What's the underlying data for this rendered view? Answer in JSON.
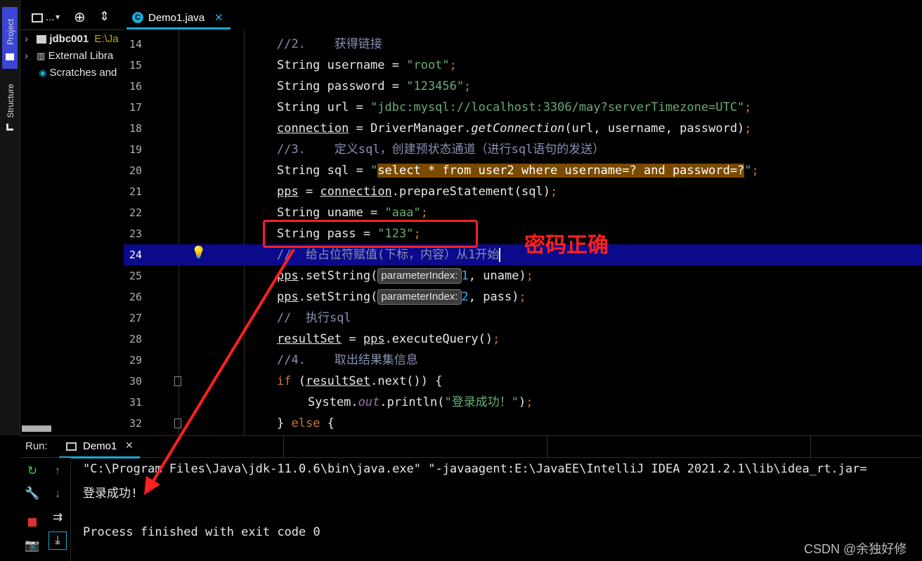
{
  "left_strip": {
    "project_label": "Project",
    "structure_label": "Structure"
  },
  "project_panel": {
    "toolbar_title": "...",
    "tree": [
      {
        "label": "jdbc001",
        "path": "E:\\Ja",
        "icon": "module-folder-icon"
      },
      {
        "label": "External Libra",
        "icon": "library-icon"
      },
      {
        "label": "Scratches and",
        "icon": "scratches-icon"
      }
    ]
  },
  "editor": {
    "tab_label": "Demo1.java",
    "lines": [
      {
        "n": "14"
      },
      {
        "n": "15"
      },
      {
        "n": "16"
      },
      {
        "n": "17"
      },
      {
        "n": "18"
      },
      {
        "n": "19"
      },
      {
        "n": "20"
      },
      {
        "n": "21"
      },
      {
        "n": "22"
      },
      {
        "n": "23"
      },
      {
        "n": "24"
      },
      {
        "n": "25"
      },
      {
        "n": "26"
      },
      {
        "n": "27"
      },
      {
        "n": "28"
      },
      {
        "n": "29"
      },
      {
        "n": "30"
      },
      {
        "n": "31"
      },
      {
        "n": "32"
      }
    ],
    "code": {
      "l14_comment": "//2.    获得链接",
      "l15_decl": "String username = ",
      "l15_str": "\"root\"",
      "l16_decl": "String password = ",
      "l16_str": "\"123456\"",
      "l17_decl": "String url = ",
      "l17_str": "\"jdbc:mysql://localhost:3306/may?serverTimezone=UTC\"",
      "l18_var": "connection",
      "l18_mid": " = DriverManager.",
      "l18_call": "getConnection",
      "l18_args": "(url, username, password)",
      "l19_comment": "//3.    定义sql，创建预状态通道（进行sql语句的发送）",
      "l20_decl": "String sql = ",
      "l20_q1": "\"",
      "l20_sql": "select * from user2 where username=? and password=?",
      "l20_q2": "\"",
      "l21_var": "pps",
      "l21_mid": " = ",
      "l21_conn": "connection",
      "l21_rest": ".prepareStatement(sql)",
      "l22_decl": "String uname = ",
      "l22_str": "\"aaa\"",
      "l23_decl": "String pass = ",
      "l23_str": "\"123\"",
      "l24_comment": "//  给占位符赋值(下标，内容）从1开始",
      "l25_var": "pps",
      "l25_call": ".setString(",
      "l25_hint": "parameterIndex:",
      "l25_num": "1",
      "l25_rest": ", uname)",
      "l26_var": "pps",
      "l26_call": ".setString(",
      "l26_hint": "parameterIndex:",
      "l26_num": "2",
      "l26_rest": ", pass)",
      "l27_comment": "//  执行sql",
      "l28_var": "resultSet",
      "l28_mid": " = ",
      "l28_pps": "pps",
      "l28_rest": ".executeQuery()",
      "l29_comment": "//4.    取出结果集信息",
      "l30_kw": "if",
      "l30_open": " (",
      "l30_var": "resultSet",
      "l30_rest": ".next()) {",
      "l31_pre": "System.",
      "l31_field": "out",
      "l31_mid": ".println(",
      "l31_str": "\"登录成功！\"",
      "l31_close": ")",
      "l32_pre": "} ",
      "l32_kw": "else",
      "l32_rest": " {"
    },
    "annotation": "密码正确"
  },
  "run_panel": {
    "run_label": "Run:",
    "tab_label": "Demo1",
    "console": [
      "\"C:\\Program Files\\Java\\jdk-11.0.6\\bin\\java.exe\" \"-javaagent:E:\\JavaEE\\IntelliJ IDEA 2021.2.1\\lib\\idea_rt.jar=",
      "登录成功!",
      "",
      "Process finished with exit code 0"
    ]
  },
  "watermark": "CSDN @余独好修",
  "colors": {
    "accent": "#3b46d6",
    "tab_underline": "#19a9d6",
    "current_line": "#0a0a8a",
    "sql_highlight": "#7a4a00",
    "annotation": "#ff2020"
  }
}
